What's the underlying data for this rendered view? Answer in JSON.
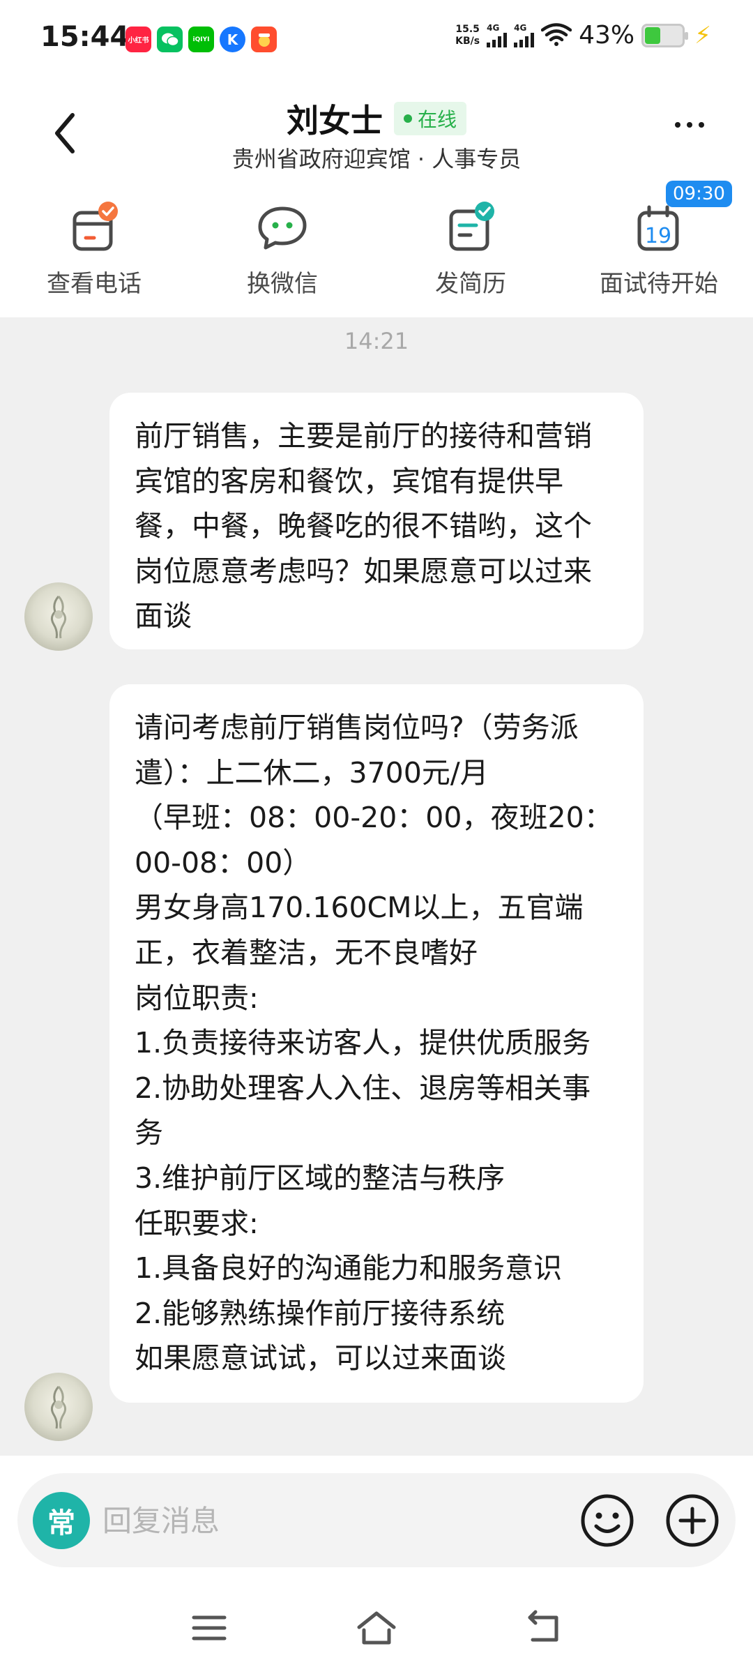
{
  "status_bar": {
    "time": "15:44",
    "app_icons": [
      {
        "name": "xiaohongshu-icon",
        "label": "小红书",
        "color": "#ff2442"
      },
      {
        "name": "wechat-icon",
        "label": "",
        "color": "#07c160"
      },
      {
        "name": "iqiyi-icon",
        "label": "iQIYI",
        "color": "#00be06"
      },
      {
        "name": "k-app-icon",
        "label": "K",
        "color": "#1677ff"
      },
      {
        "name": "food-app-icon",
        "label": "",
        "color": "#ff4d2e"
      }
    ],
    "net_speed_value": "15.5",
    "net_speed_unit": "KB/s",
    "signal1_label": "4G",
    "signal2_label": "4G",
    "battery_percent": "43%",
    "battery_level": 0.43
  },
  "header": {
    "contact_name": "刘女士",
    "online_status": "在线",
    "subtitle": "贵州省政府迎宾馆 · 人事专员"
  },
  "actions": [
    {
      "label": "查看电话"
    },
    {
      "label": "换微信"
    },
    {
      "label": "发简历"
    },
    {
      "label": "面试待开始",
      "time_tag": "09:30",
      "calendar_day": "19"
    }
  ],
  "chat": {
    "timestamp": "14:21",
    "messages": [
      {
        "text": "前厅销售，主要是前厅的接待和营销宾馆的客房和餐饮，宾馆有提供早餐，中餐，晚餐吃的很不错哟，这个岗位愿意考虑吗？如果愿意可以过来面谈"
      },
      {
        "text": "请问考虑前厅销售岗位吗?（劳务派遣）：上二休二，3700元/月\n（早班：08：00-20：00，夜班20：00-08：00）\n男女身高170.160CM以上，五官端正，衣着整洁，无不良嗜好\n岗位职责:\n1.负责接待来访客人，提供优质服务\n2.协助处理客人入住、退房等相关事务\n3.维护前厅区域的整洁与秩序\n任职要求:\n1.具备良好的沟通能力和服务意识\n2.能够熟练操作前厅接待系统\n如果愿意试试，可以过来面谈"
      }
    ]
  },
  "input": {
    "common_label": "常",
    "placeholder": "回复消息",
    "value": ""
  },
  "colors": {
    "accent_teal": "#1fb4a8",
    "online_green": "#27b04a",
    "tag_blue": "#1e8cf0",
    "chat_background": "#f0f0f0"
  }
}
